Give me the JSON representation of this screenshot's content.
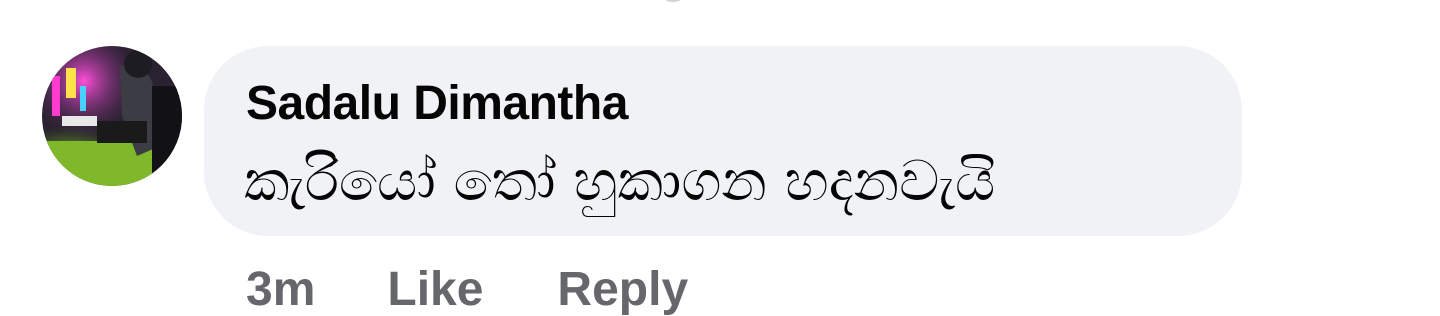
{
  "comment": {
    "author_name": "Sadalu Dimantha",
    "text": "කැරියෝ  තෝ හුකාගන හදනවැයි",
    "timestamp": "3m",
    "like_label": "Like",
    "reply_label": "Reply"
  },
  "colors": {
    "bubble_background": "#f0f2f5",
    "author_text": "#050505",
    "meta_text": "#65676b"
  }
}
